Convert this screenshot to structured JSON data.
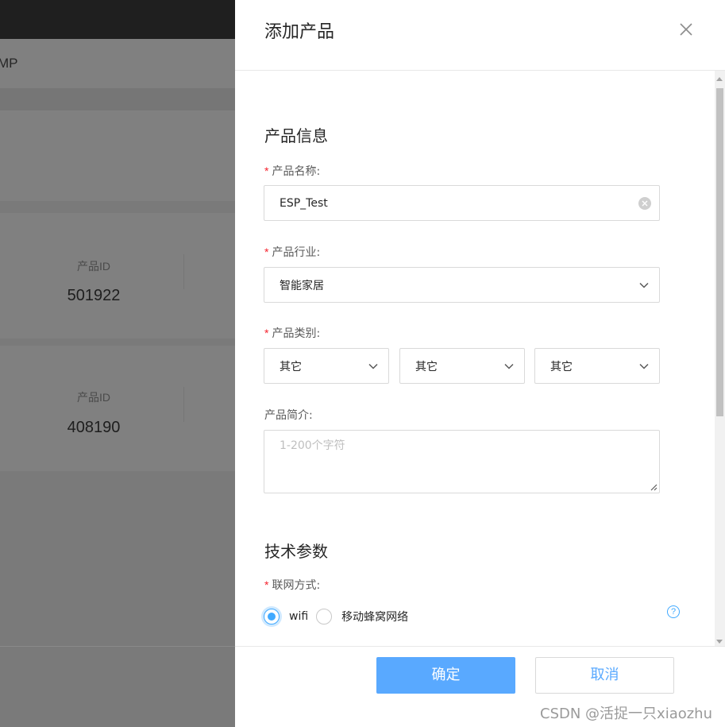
{
  "background": {
    "header_text": "MP",
    "cards": [
      {
        "label": "产品ID",
        "value": "501922"
      },
      {
        "label": "产品ID",
        "value": "408190"
      }
    ]
  },
  "drawer": {
    "title": "添加产品",
    "sections": {
      "product_info": "产品信息",
      "tech_params": "技术参数"
    },
    "fields": {
      "name": {
        "label": "产品名称:",
        "value": "ESP_Test"
      },
      "industry": {
        "label": "产品行业:",
        "value": "智能家居"
      },
      "category": {
        "label": "产品类别:",
        "values": [
          "其它",
          "其它",
          "其它"
        ]
      },
      "description": {
        "label": "产品简介:",
        "placeholder": "1-200个字符"
      },
      "network": {
        "label": "联网方式:",
        "options": [
          "wifi",
          "移动蜂窝网络"
        ],
        "selected": "wifi"
      }
    },
    "help_icon": "?",
    "footer": {
      "confirm": "确定",
      "cancel": "取消"
    }
  },
  "watermark": "CSDN @活捉一只xiaozhu",
  "colors": {
    "primary": "#59a9ff",
    "radio_accent": "#40a9ff",
    "required": "#f5222d",
    "overlay": "#7a7a7a"
  }
}
